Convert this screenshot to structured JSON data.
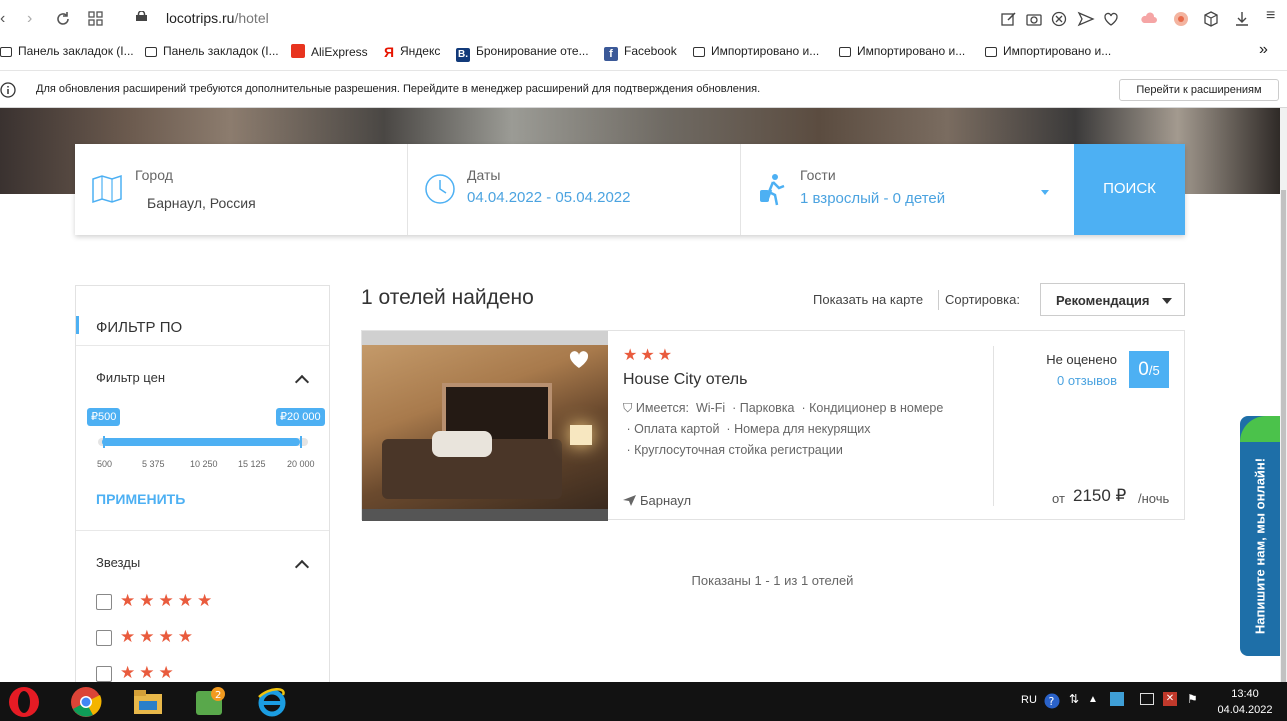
{
  "browser": {
    "url_host": "locotrips.ru",
    "url_path": "/hotel",
    "bookmarks": [
      "Панель закладок (I...",
      "Панель закладок (I...",
      "AliExpress",
      "Яндекс",
      "Бронирование оте...",
      "Facebook",
      "Импортировано и...",
      "Импортировано и...",
      "Импортировано и..."
    ],
    "bookmarks_more": "»",
    "infobar_message": "Для обновления расширений требуются дополнительные разрешения. Перейдите в менеджер расширений для подтверждения обновления.",
    "infobar_button": "Перейти к расширениям"
  },
  "search": {
    "city_label": "Город",
    "city_value": "Барнаул, Россия",
    "dates_label": "Даты",
    "dates_value": "04.04.2022 - 05.04.2022",
    "guests_label": "Гости",
    "guests_value": "1 взрослый - 0 детей",
    "button": "ПОИСК"
  },
  "filter": {
    "title": "ФИЛЬТР ПО",
    "price_title": "Фильтр цен",
    "price_min_label": "₽500",
    "price_max_label": "₽20 000",
    "price_range_min": 500,
    "price_range_max": 20000,
    "ticks": [
      "500",
      "5 375",
      "10 250",
      "15 125",
      "20 000"
    ],
    "apply": "ПРИМЕНИТЬ",
    "stars_title": "Звезды",
    "star_rows": [
      "★★★★★",
      "★★★★",
      "★★★"
    ]
  },
  "results": {
    "title": "1 отелей найдено",
    "map_link": "Показать на карте",
    "sort_label": "Сортировка:",
    "sort_value": "Рекомендация",
    "pager": "Показаны 1 - 1 из 1 отелей"
  },
  "hotel": {
    "stars": "★★★",
    "name": "House City отель",
    "amenities_prefix": "Имеется:",
    "amenities": [
      "Wi-Fi",
      "Парковка",
      "Кондиционер в номере",
      "Оплата картой",
      "Номера для некурящих",
      "Круглосуточная стойка регистрации"
    ],
    "city": "Барнаул",
    "rating_text": "Не оценено",
    "reviews": "0 отзывов",
    "rating_value": "0",
    "rating_scale": "/5",
    "price_from": "от",
    "price": "2150 ₽",
    "price_unit": "/ночь"
  },
  "chat": {
    "label": "Напишите нам, мы онлайн!"
  },
  "taskbar": {
    "lang": "RU",
    "time": "13:40",
    "date": "04.04.2022"
  },
  "colors": {
    "accent": "#4db0f3",
    "link": "#4ba3e0",
    "star": "#e95b3d",
    "chat": "#1e6fa8"
  }
}
